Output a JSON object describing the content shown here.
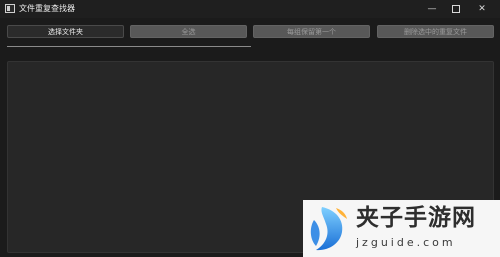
{
  "window": {
    "title": "文件重复查找器",
    "minimize_glyph": "—",
    "close_glyph": "✕"
  },
  "toolbar": {
    "select_folder": "选择文件夹",
    "select_all": "全选",
    "keep_first_each_group": "每组保留第一个",
    "delete_selected_duplicates": "删除选中的重复文件"
  },
  "progress": {
    "value": 0.5
  },
  "watermark": {
    "title": "夹子手游网",
    "url": "jzguide.com"
  }
}
